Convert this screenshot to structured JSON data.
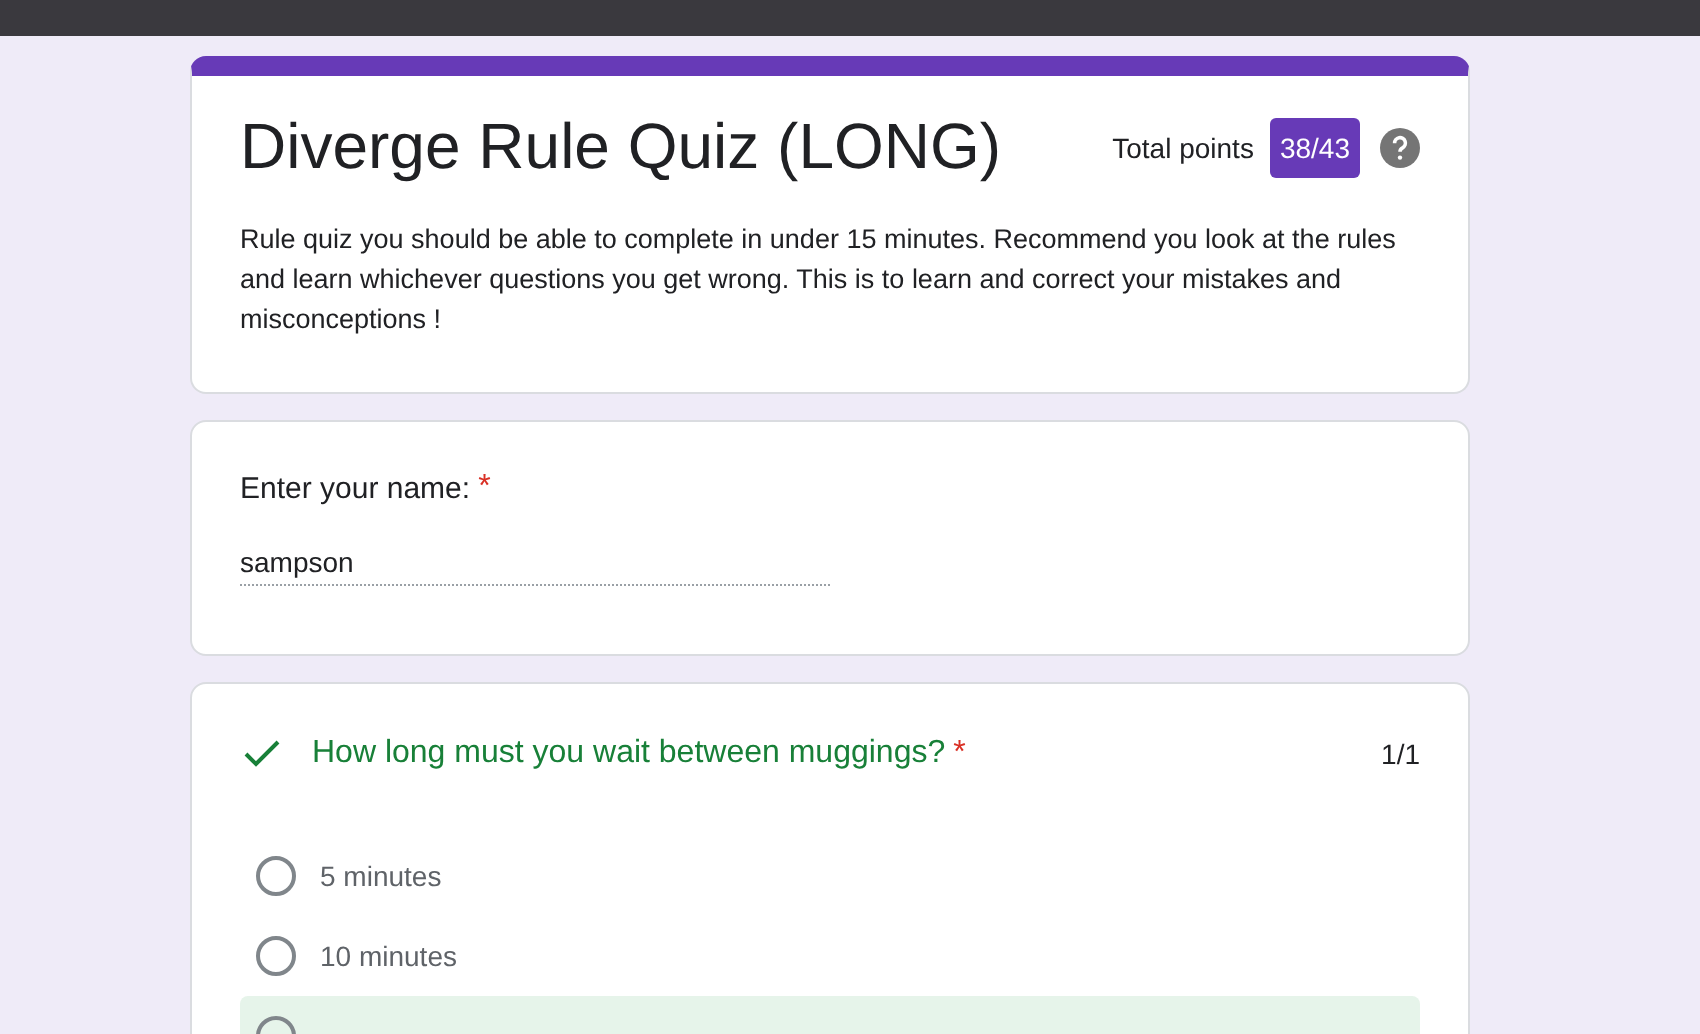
{
  "header": {
    "title": "Diverge Rule Quiz (LONG)",
    "points_label": "Total points",
    "points": "38/43",
    "description": "Rule quiz you should be able to complete in under 15 minutes. Recommend you look at the rules and learn whichever questions you get wrong. This is to learn and correct your mistakes and misconceptions !"
  },
  "name_question": {
    "label": "Enter your name:",
    "required_mark": "*",
    "value": "sampson"
  },
  "questions": [
    {
      "text": "How long must you wait between muggings?",
      "required_mark": "*",
      "correct": true,
      "score": "1/1",
      "options": [
        {
          "label": "5 minutes",
          "correct": false
        },
        {
          "label": "10 minutes",
          "correct": false
        },
        {
          "correct": true
        }
      ]
    }
  ]
}
